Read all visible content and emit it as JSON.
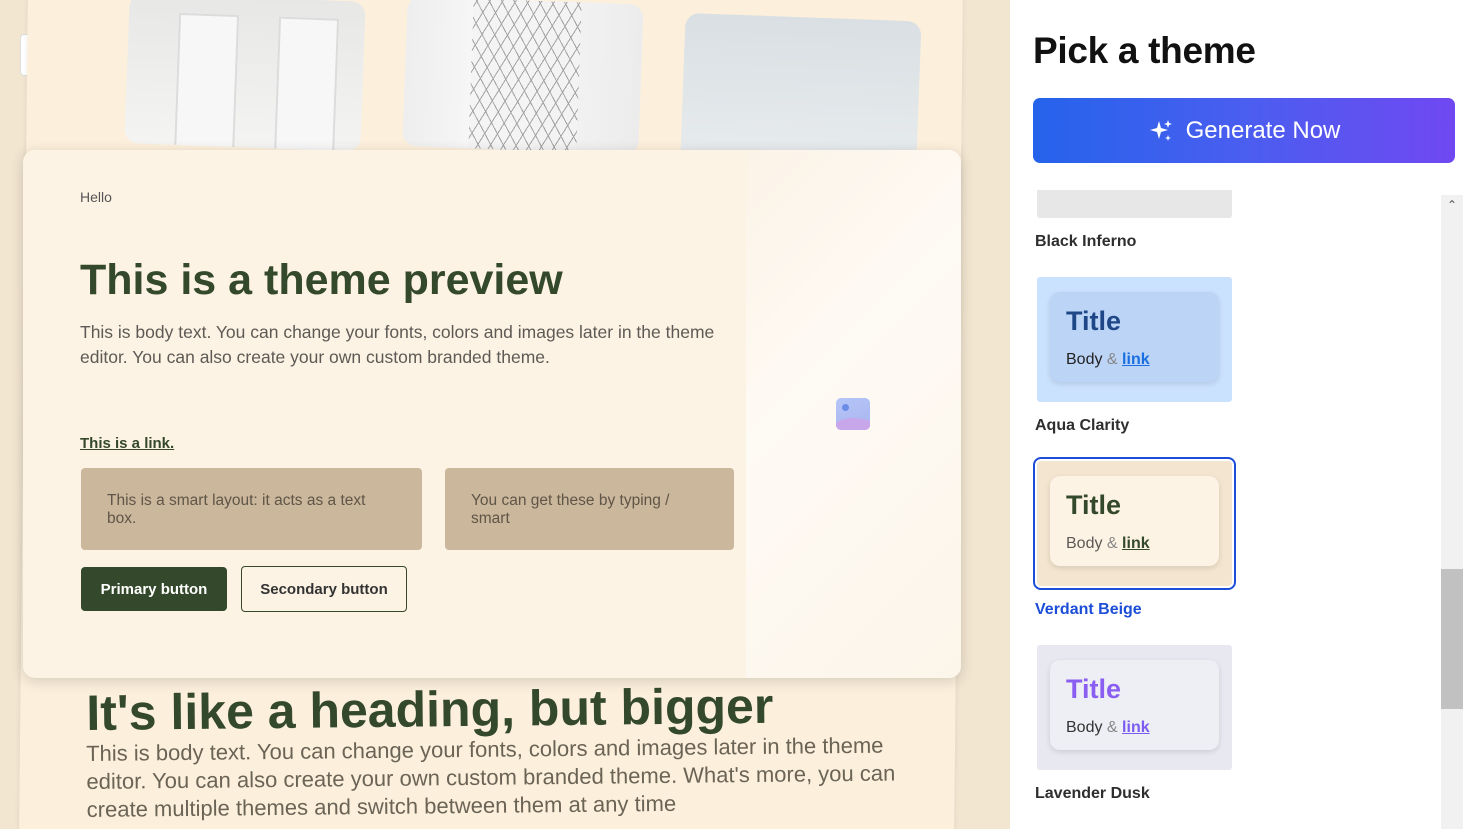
{
  "background": {
    "heading": "It's like a heading, but bigger",
    "body": "This is body text. You can change your fonts, colors and images later in the theme editor. You can also create your own custom branded theme. What's more, you can create multiple themes and switch between them at any time"
  },
  "preview": {
    "eyebrow": "Hello",
    "title": "This is a theme preview",
    "body": "This is body text. You can change your fonts, colors and images later in the theme editor. You can also create your own custom branded theme.",
    "link": "This is a link.",
    "smart_box_1": "This is a smart layout: it acts as a text box.",
    "smart_box_2": "You can get these by typing / smart",
    "primary_button": "Primary button",
    "secondary_button": "Secondary button",
    "image_icon": "image-placeholder-icon"
  },
  "panel": {
    "title": "Pick a theme",
    "generate_button": "Generate Now",
    "generate_icon": "sparkle-icon",
    "themes": [
      {
        "name": "Black Inferno",
        "title": "",
        "body": "",
        "amp": "",
        "link": "",
        "selected": false
      },
      {
        "name": "Aqua Clarity",
        "title": "Title",
        "body": "Body",
        "amp": "&",
        "link": "link",
        "selected": false
      },
      {
        "name": "Verdant Beige",
        "title": "Title",
        "body": "Body",
        "amp": "&",
        "link": "link",
        "selected": true
      },
      {
        "name": "Lavender Dusk",
        "title": "Title",
        "body": "Body",
        "amp": "&",
        "link": "link",
        "selected": false
      }
    ]
  },
  "colors": {
    "accent_green": "#34492b",
    "selected_blue": "#1d4ed8",
    "generate_gradient_start": "#2563eb",
    "generate_gradient_end": "#7048f2"
  }
}
